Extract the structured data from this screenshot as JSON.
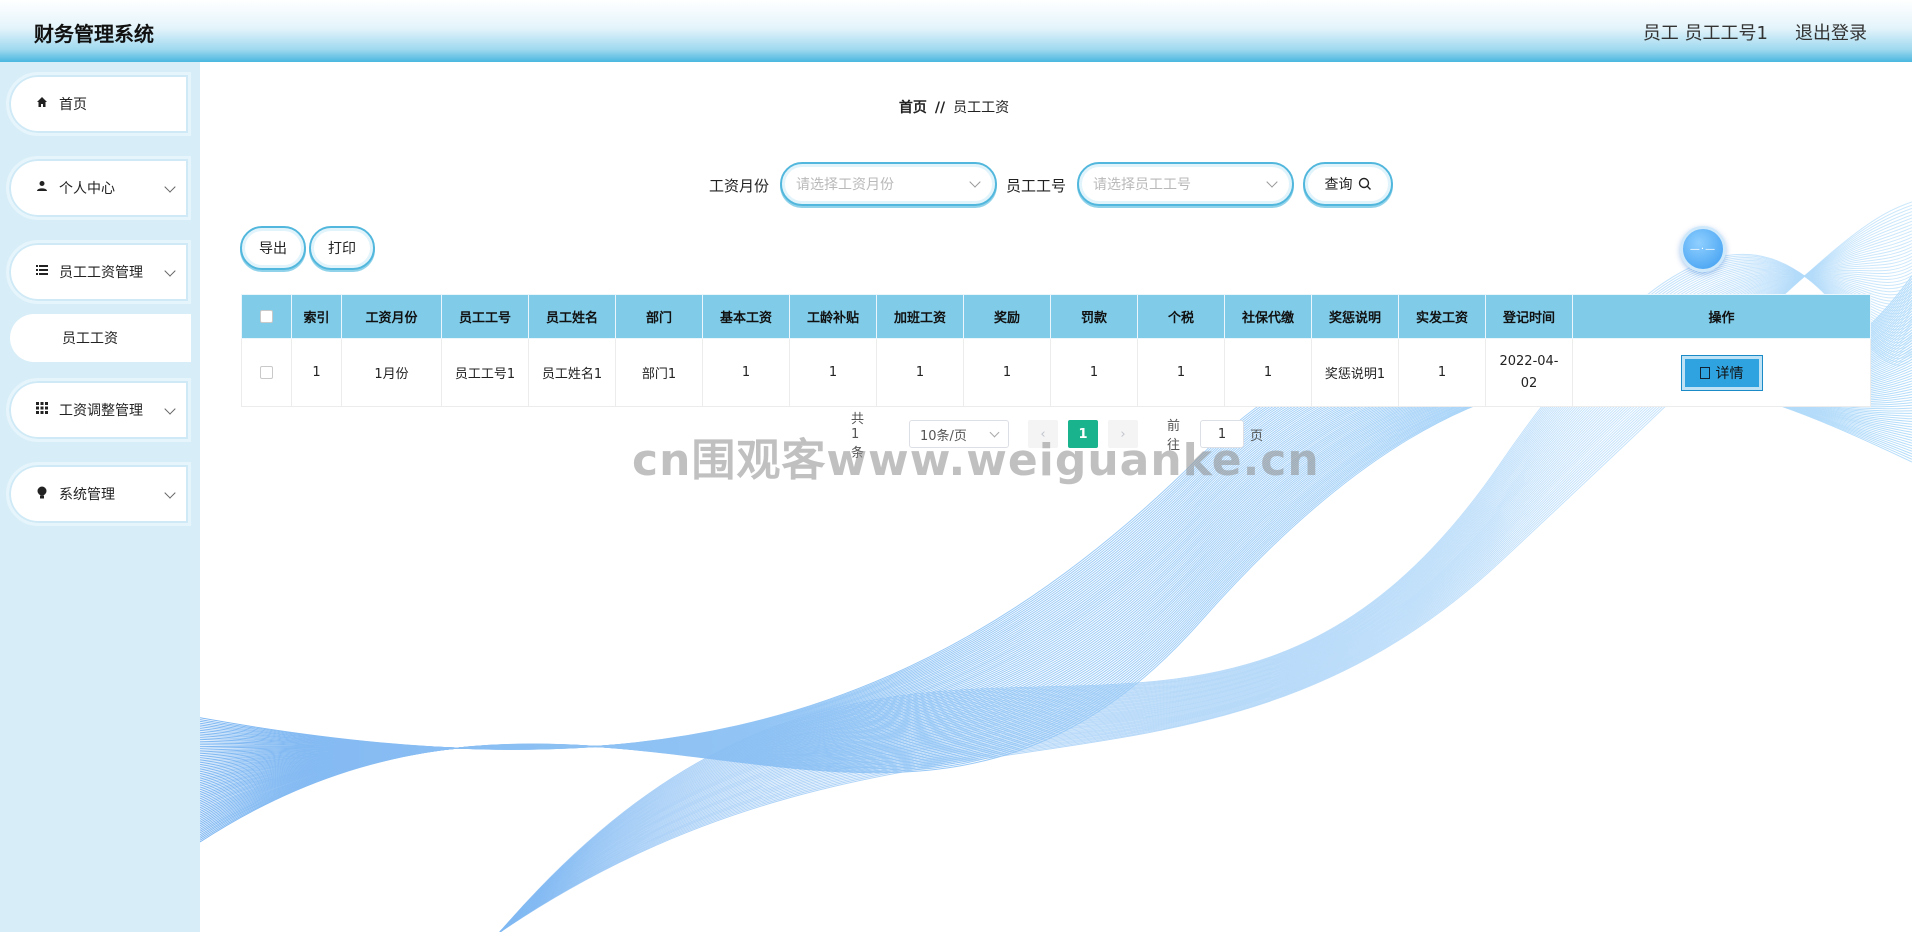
{
  "header": {
    "title": "财务管理系统",
    "user": "员工 员工工号1",
    "logout": "退出登录"
  },
  "sidebar": {
    "items": [
      {
        "label": "首页",
        "icon": "home-icon"
      },
      {
        "label": "个人中心",
        "icon": "user-icon"
      },
      {
        "label": "员工工资管理",
        "icon": "list-icon"
      },
      {
        "label": "员工工资",
        "icon": ""
      },
      {
        "label": "工资调整管理",
        "icon": "grid-icon"
      },
      {
        "label": "系统管理",
        "icon": "bulb-icon"
      }
    ]
  },
  "breadcrumb": {
    "home": "首页",
    "sep": "//",
    "current": "员工工资"
  },
  "search": {
    "month_label": "工资月份",
    "month_placeholder": "请选择工资月份",
    "empno_label": "员工工号",
    "empno_placeholder": "请选择员工工号",
    "query_label": "查询"
  },
  "toolbar": {
    "export_label": "导出",
    "print_label": "打印"
  },
  "table": {
    "columns": [
      "索引",
      "工资月份",
      "员工工号",
      "员工姓名",
      "部门",
      "基本工资",
      "工龄补贴",
      "加班工资",
      "奖励",
      "罚款",
      "个税",
      "社保代缴",
      "奖惩说明",
      "实发工资",
      "登记时间",
      "操作"
    ],
    "rows": [
      {
        "cells": [
          "1",
          "1月份",
          "员工工号1",
          "员工姓名1",
          "部门1",
          "1",
          "1",
          "1",
          "1",
          "1",
          "1",
          "1",
          "奖惩说明1",
          "1",
          "2022-04-02"
        ],
        "action_label": "详情"
      }
    ]
  },
  "pagination": {
    "total": "共 1 条",
    "page_size": "10条/页",
    "current_page": "1",
    "goto_label": "前往",
    "goto_value": "1",
    "page_suffix": "页"
  },
  "watermark": "cn围观客www.weiguanke.cn"
}
